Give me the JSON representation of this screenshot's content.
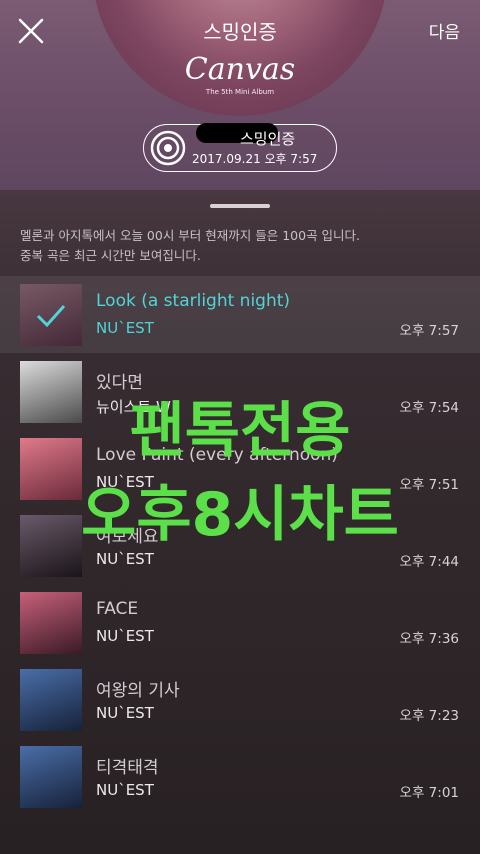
{
  "header": {
    "verify_title": "스밍인증",
    "next_label": "다음",
    "album_title": "Canvas",
    "album_subtitle": "The 5th Mini Album"
  },
  "badge": {
    "title": "스밍인증",
    "timestamp": "2017.09.21 오후 7:57"
  },
  "notice": {
    "line1": "멜론과 아지톡에서 오늘 00시 부터 현재까지 들은 100곡 입니다.",
    "line2": "중복 곡은 최근 시간만 보여집니다."
  },
  "songs": [
    {
      "title": "Look (a starlight night)",
      "artist": "NU`EST",
      "time": "오후 7:57",
      "selected": true,
      "art_colors": [
        "#b88a9c",
        "#6a3e55"
      ]
    },
    {
      "title": "있다면",
      "artist": "뉴이스트 W",
      "time": "오후 7:54",
      "selected": false,
      "art_colors": [
        "#dcdcdc",
        "#4a4a4a"
      ]
    },
    {
      "title": "Love Paint (every afternoon)",
      "artist": "NU`EST",
      "time": "오후 7:51",
      "selected": false,
      "art_colors": [
        "#e07a8a",
        "#6a2a3a"
      ]
    },
    {
      "title": "여보세요",
      "artist": "NU`EST",
      "time": "오후 7:44",
      "selected": false,
      "art_colors": [
        "#6a5a6a",
        "#1a1418"
      ]
    },
    {
      "title": "FACE",
      "artist": "NU`EST",
      "time": "오후 7:36",
      "selected": false,
      "art_colors": [
        "#c7607a",
        "#3a1a26"
      ]
    },
    {
      "title": "여왕의 기사",
      "artist": "NU`EST",
      "time": "오후 7:23",
      "selected": false,
      "art_colors": [
        "#4a6ea8",
        "#16223a"
      ]
    },
    {
      "title": "티격태격",
      "artist": "NU`EST",
      "time": "오후 7:01",
      "selected": false,
      "art_colors": [
        "#4a6ea8",
        "#16223a"
      ]
    }
  ],
  "overlay": {
    "line1": "팬톡전용",
    "line2": "오후8시차트"
  },
  "colors": {
    "accent": "#51d4d8",
    "overlay_text": "#5ce04a"
  }
}
